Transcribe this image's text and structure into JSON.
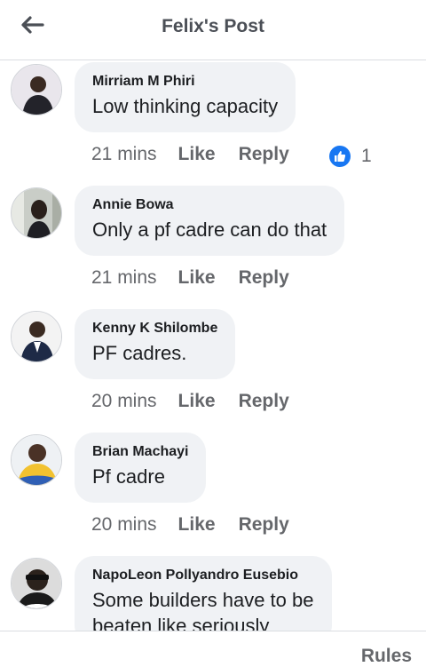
{
  "header": {
    "title": "Felix's Post",
    "back_icon": "arrow-left-icon"
  },
  "comments": [
    {
      "author": "Mirriam M Phiri",
      "text": "Low thinking capacity",
      "time": "21 mins",
      "like_label": "Like",
      "reply_label": "Reply",
      "reactions": {
        "icon": "like-reaction-icon",
        "count": "1"
      }
    },
    {
      "author": "Annie Bowa",
      "text": "Only a pf cadre can do that",
      "time": "21 mins",
      "like_label": "Like",
      "reply_label": "Reply"
    },
    {
      "author": "Kenny K Shilombe",
      "text": "PF cadres.",
      "time": "20 mins",
      "like_label": "Like",
      "reply_label": "Reply"
    },
    {
      "author": "Brian Machayi",
      "text": "Pf cadre",
      "time": "20 mins",
      "like_label": "Like",
      "reply_label": "Reply"
    },
    {
      "author": "NapoLeon Pollyandro Eusebio",
      "text": "Some builders have to be",
      "text_2": "beaten like seriously"
    }
  ],
  "footer": {
    "rules_label": "Rules"
  },
  "colors": {
    "accent": "#1877f2",
    "bubble": "#f0f2f5",
    "meta": "#65676b"
  }
}
